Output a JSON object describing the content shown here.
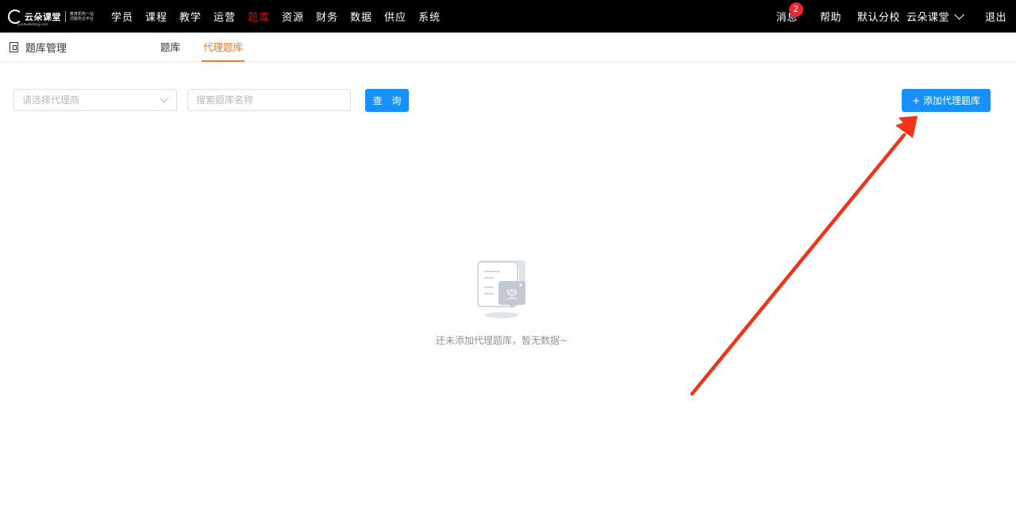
{
  "app": {
    "logo": {
      "name": "云朵课堂",
      "slogan_line1": "教育机构一站",
      "slogan_line2": "式服务云平台",
      "url": "yunduoketang.com"
    },
    "nav": [
      {
        "label": "学员"
      },
      {
        "label": "课程"
      },
      {
        "label": "教学"
      },
      {
        "label": "运营"
      },
      {
        "label": "题库",
        "active": true
      },
      {
        "label": "资源"
      },
      {
        "label": "财务"
      },
      {
        "label": "数据"
      },
      {
        "label": "供应"
      },
      {
        "label": "系统"
      }
    ],
    "top_right": {
      "messages": "消息",
      "message_count": "2",
      "help": "帮助",
      "branch": "默认分校",
      "user": "云朵课堂",
      "logout": "退出"
    },
    "accent_color": "#f07a2e",
    "nav_active_color": "#d9001b",
    "primary_color": "#1890ff"
  },
  "module": {
    "title": "题库管理",
    "icon": "book-icon"
  },
  "tabs": [
    {
      "label": "题库",
      "active": false
    },
    {
      "label": "代理题库",
      "active": true
    }
  ],
  "filters": {
    "agent_select_placeholder": "请选择代理商",
    "search_placeholder": "搜索题库名称",
    "query_label": "查 询",
    "add_label": "+ 添加代理题库"
  },
  "empty": {
    "icon_text": "空",
    "message": "还未添加代理题库，暂无数据~"
  }
}
